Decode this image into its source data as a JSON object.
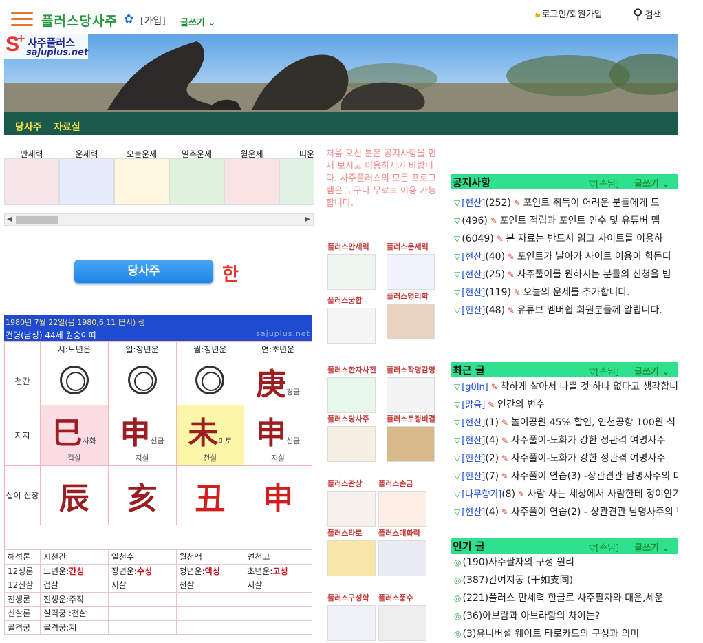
{
  "header": {
    "site_title": "플러스당사주",
    "join": "[가입]",
    "write": "글쓰기",
    "login": "로그인/회원가입",
    "search": "검색"
  },
  "banner": {
    "logo_text": "사주플러스",
    "logo_url": "sajuplus.net",
    "category1": "당사주",
    "category2": "자료실"
  },
  "thumbs": [
    {
      "label": "만세력",
      "bg": "#f6e6ea"
    },
    {
      "label": "운세력",
      "bg": "#e6ecf9"
    },
    {
      "label": "오늘운세",
      "bg": "#fff6e0"
    },
    {
      "label": "일주운세",
      "bg": "#dff3dc"
    },
    {
      "label": "월운세",
      "bg": "#fbe4e4"
    },
    {
      "label": "띠운",
      "bg": "#e0f2e4"
    }
  ],
  "notice_text": "처음 오신 분은 공지사항을 먼저 보시고 이용하시기 바랍니다. 사주플러스의 모든 프로그램은 누구나 무료로 이용 가능합니다.",
  "dangsaju_button": "당사주",
  "han_label": "한",
  "chart": {
    "line1": "1980년 7월 22일(음 1980,6,11 巳시) 생",
    "line2": "건명(남성) 44세   원숭이띠",
    "watermark": "sajuplus.net",
    "col_heads": [
      "시:노년운",
      "일:장년운",
      "월:청년운",
      "연:초년운"
    ],
    "row_cheongan": "천간",
    "row_jiji": "지지",
    "row_sipi": "십이 신장",
    "cheongan": [
      "◎",
      "◎",
      "◎",
      "庚"
    ],
    "cheongan_sub": [
      "",
      "",
      "",
      "경금"
    ],
    "jiji": [
      "巳",
      "申",
      "未",
      "申"
    ],
    "jiji_sub": [
      "사화",
      "신금",
      "미토",
      "신금"
    ],
    "jiji_sal": [
      "겁살",
      "지살",
      "천살",
      "지살"
    ],
    "sipi": [
      "辰",
      "亥",
      "丑",
      "申"
    ]
  },
  "lower_table": [
    {
      "k": "해석론",
      "v": [
        "시천간",
        "일천수",
        "월천액",
        "연천고"
      ]
    },
    {
      "k": "12성론",
      "v": [
        "노년운:",
        "장년운:",
        "청년운:",
        "초년운:"
      ],
      "r": [
        "간성",
        "수성",
        "액성",
        "고성"
      ]
    },
    {
      "k": "12신살",
      "v": [
        "겁살",
        "지살",
        "천살",
        "지살"
      ]
    },
    {
      "k": "전생론",
      "v": [
        "전생운:주작",
        "",
        "",
        ""
      ]
    },
    {
      "k": "신살론",
      "v": [
        "살격궁 :천살",
        "",
        "",
        ""
      ]
    },
    {
      "k": "골격궁",
      "v": [
        "골격궁:계",
        "",
        "",
        ""
      ]
    }
  ],
  "programs": [
    {
      "label": "플러스만세력",
      "bg": "#eef6f0"
    },
    {
      "label": "플러스운세력",
      "bg": "#f3f3ff"
    },
    {
      "label": "플러스궁합",
      "bg": "#f5f5f5"
    },
    {
      "label": "플러스명리학",
      "bg": "#e8d2c2"
    },
    {
      "label": "플러스한자사전",
      "bg": "#e7f7ea"
    },
    {
      "label": "플러스작명감명",
      "bg": "#f4f4f4"
    },
    {
      "label": "플러스당사주",
      "bg": "#f6efe2"
    },
    {
      "label": "플러스토정비결",
      "bg": "#d9b98b"
    },
    {
      "label": "플러스관상",
      "bg": "#f6f1ea"
    },
    {
      "label": "플러스손금",
      "bg": "#fbefe6"
    },
    {
      "label": "플러스타로",
      "bg": "#f7e6a8"
    },
    {
      "label": "플러스매화력",
      "bg": "#e9edf3"
    },
    {
      "label": "플러스구성학",
      "bg": "#eef1f6"
    },
    {
      "label": "플러스풍수",
      "bg": "#eeeeee"
    }
  ],
  "boards": {
    "guest": "[손님]",
    "write": "글쓰기",
    "notice": {
      "title": "공지사항",
      "rows": [
        {
          "tag": "[현산]",
          "count": "(252)",
          "text": "포인트 취득이 어려운 분들에게 드"
        },
        {
          "tag": "",
          "count": "(496)",
          "text": "포인트 적립과 포인트 인수 및 유튜버 멤"
        },
        {
          "tag": "",
          "count": "(6049)",
          "text": "본 자료는 반드시 읽고 사이트를 이용하"
        },
        {
          "tag": "[현산]",
          "count": "(40)",
          "text": "포인트가 날아가 사이트 이용이 힘든디"
        },
        {
          "tag": "[현산]",
          "count": "(25)",
          "text": "사주풀이를 원하시는 분들의 신청을 빋"
        },
        {
          "tag": "[현산]",
          "count": "(119)",
          "text": "오늘의 운세를 추가합니다."
        },
        {
          "tag": "[현산]",
          "count": "(48)",
          "text": "유튜브 멤버쉽 회원분들께 알립니다."
        }
      ]
    },
    "recent": {
      "title": "최근 글",
      "rows": [
        {
          "tag": "[g0ln]",
          "count": "",
          "text": "착하게 살아서 나쁠 것 하나 없다고 생각합니"
        },
        {
          "tag": "[맑음]",
          "count": "",
          "text": "인간의 변수"
        },
        {
          "tag": "[현산]",
          "count": "(1)",
          "text": "놀이공원 45% 할인, 인천공항 100원 식"
        },
        {
          "tag": "[현산]",
          "count": "(4)",
          "text": "사주풀이-도화가 강한 정관격 여명사주"
        },
        {
          "tag": "[현산]",
          "count": "(2)",
          "text": "사주풀이-도화가 강한 정관격 여명사주"
        },
        {
          "tag": "[현산]",
          "count": "(7)",
          "text": "사주풀이 연습(3) -상관견관 남명사주의 대"
        },
        {
          "tag": "[나무향기]",
          "count": "(8)",
          "text": "사람 사는 세상에서 사람한테 정이안가"
        },
        {
          "tag": "[현산]",
          "count": "(4)",
          "text": "사주풀이 연습(2) - 상관견관 남명사주의 현"
        }
      ]
    },
    "popular": {
      "title": "인기 글",
      "rows": [
        {
          "tag": "",
          "count": "(190)",
          "text": "사주팔자의 구성 원리"
        },
        {
          "tag": "",
          "count": "(387)",
          "text": "간여지동 (干如支同)"
        },
        {
          "tag": "",
          "count": "(221)",
          "text": "플러스 만세력 한글로 사주팔자와 대운,세운"
        },
        {
          "tag": "",
          "count": "(36)",
          "text": "아브람과 아브라함의 차이는?"
        },
        {
          "tag": "",
          "count": "(3)",
          "text": "유니버셜 웨이트 타로카드의 구성과 의미"
        }
      ]
    }
  }
}
